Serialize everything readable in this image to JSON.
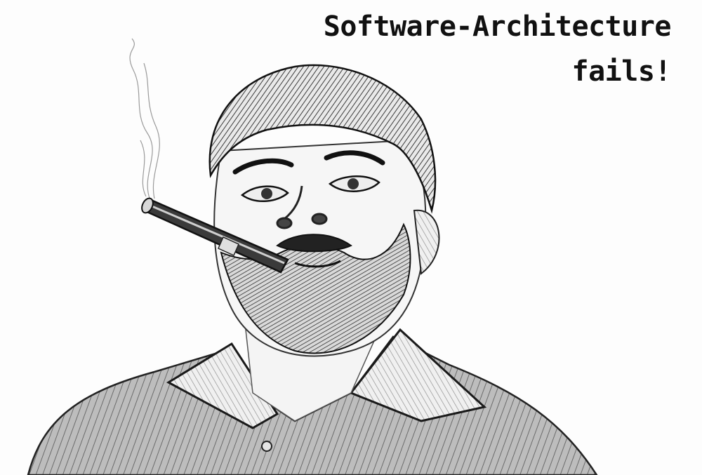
{
  "caption": {
    "line1": "Software-Architecture",
    "line2": "fails!"
  },
  "illustration": {
    "subject": "pencil-sketch-portrait-man-with-cigar",
    "style": "graphite pencil sketch",
    "colors": {
      "paper": "#fdfdfd",
      "graphite_dark": "#1a1a1a",
      "graphite_mid": "#555555",
      "graphite_light": "#9a9a9a"
    }
  }
}
